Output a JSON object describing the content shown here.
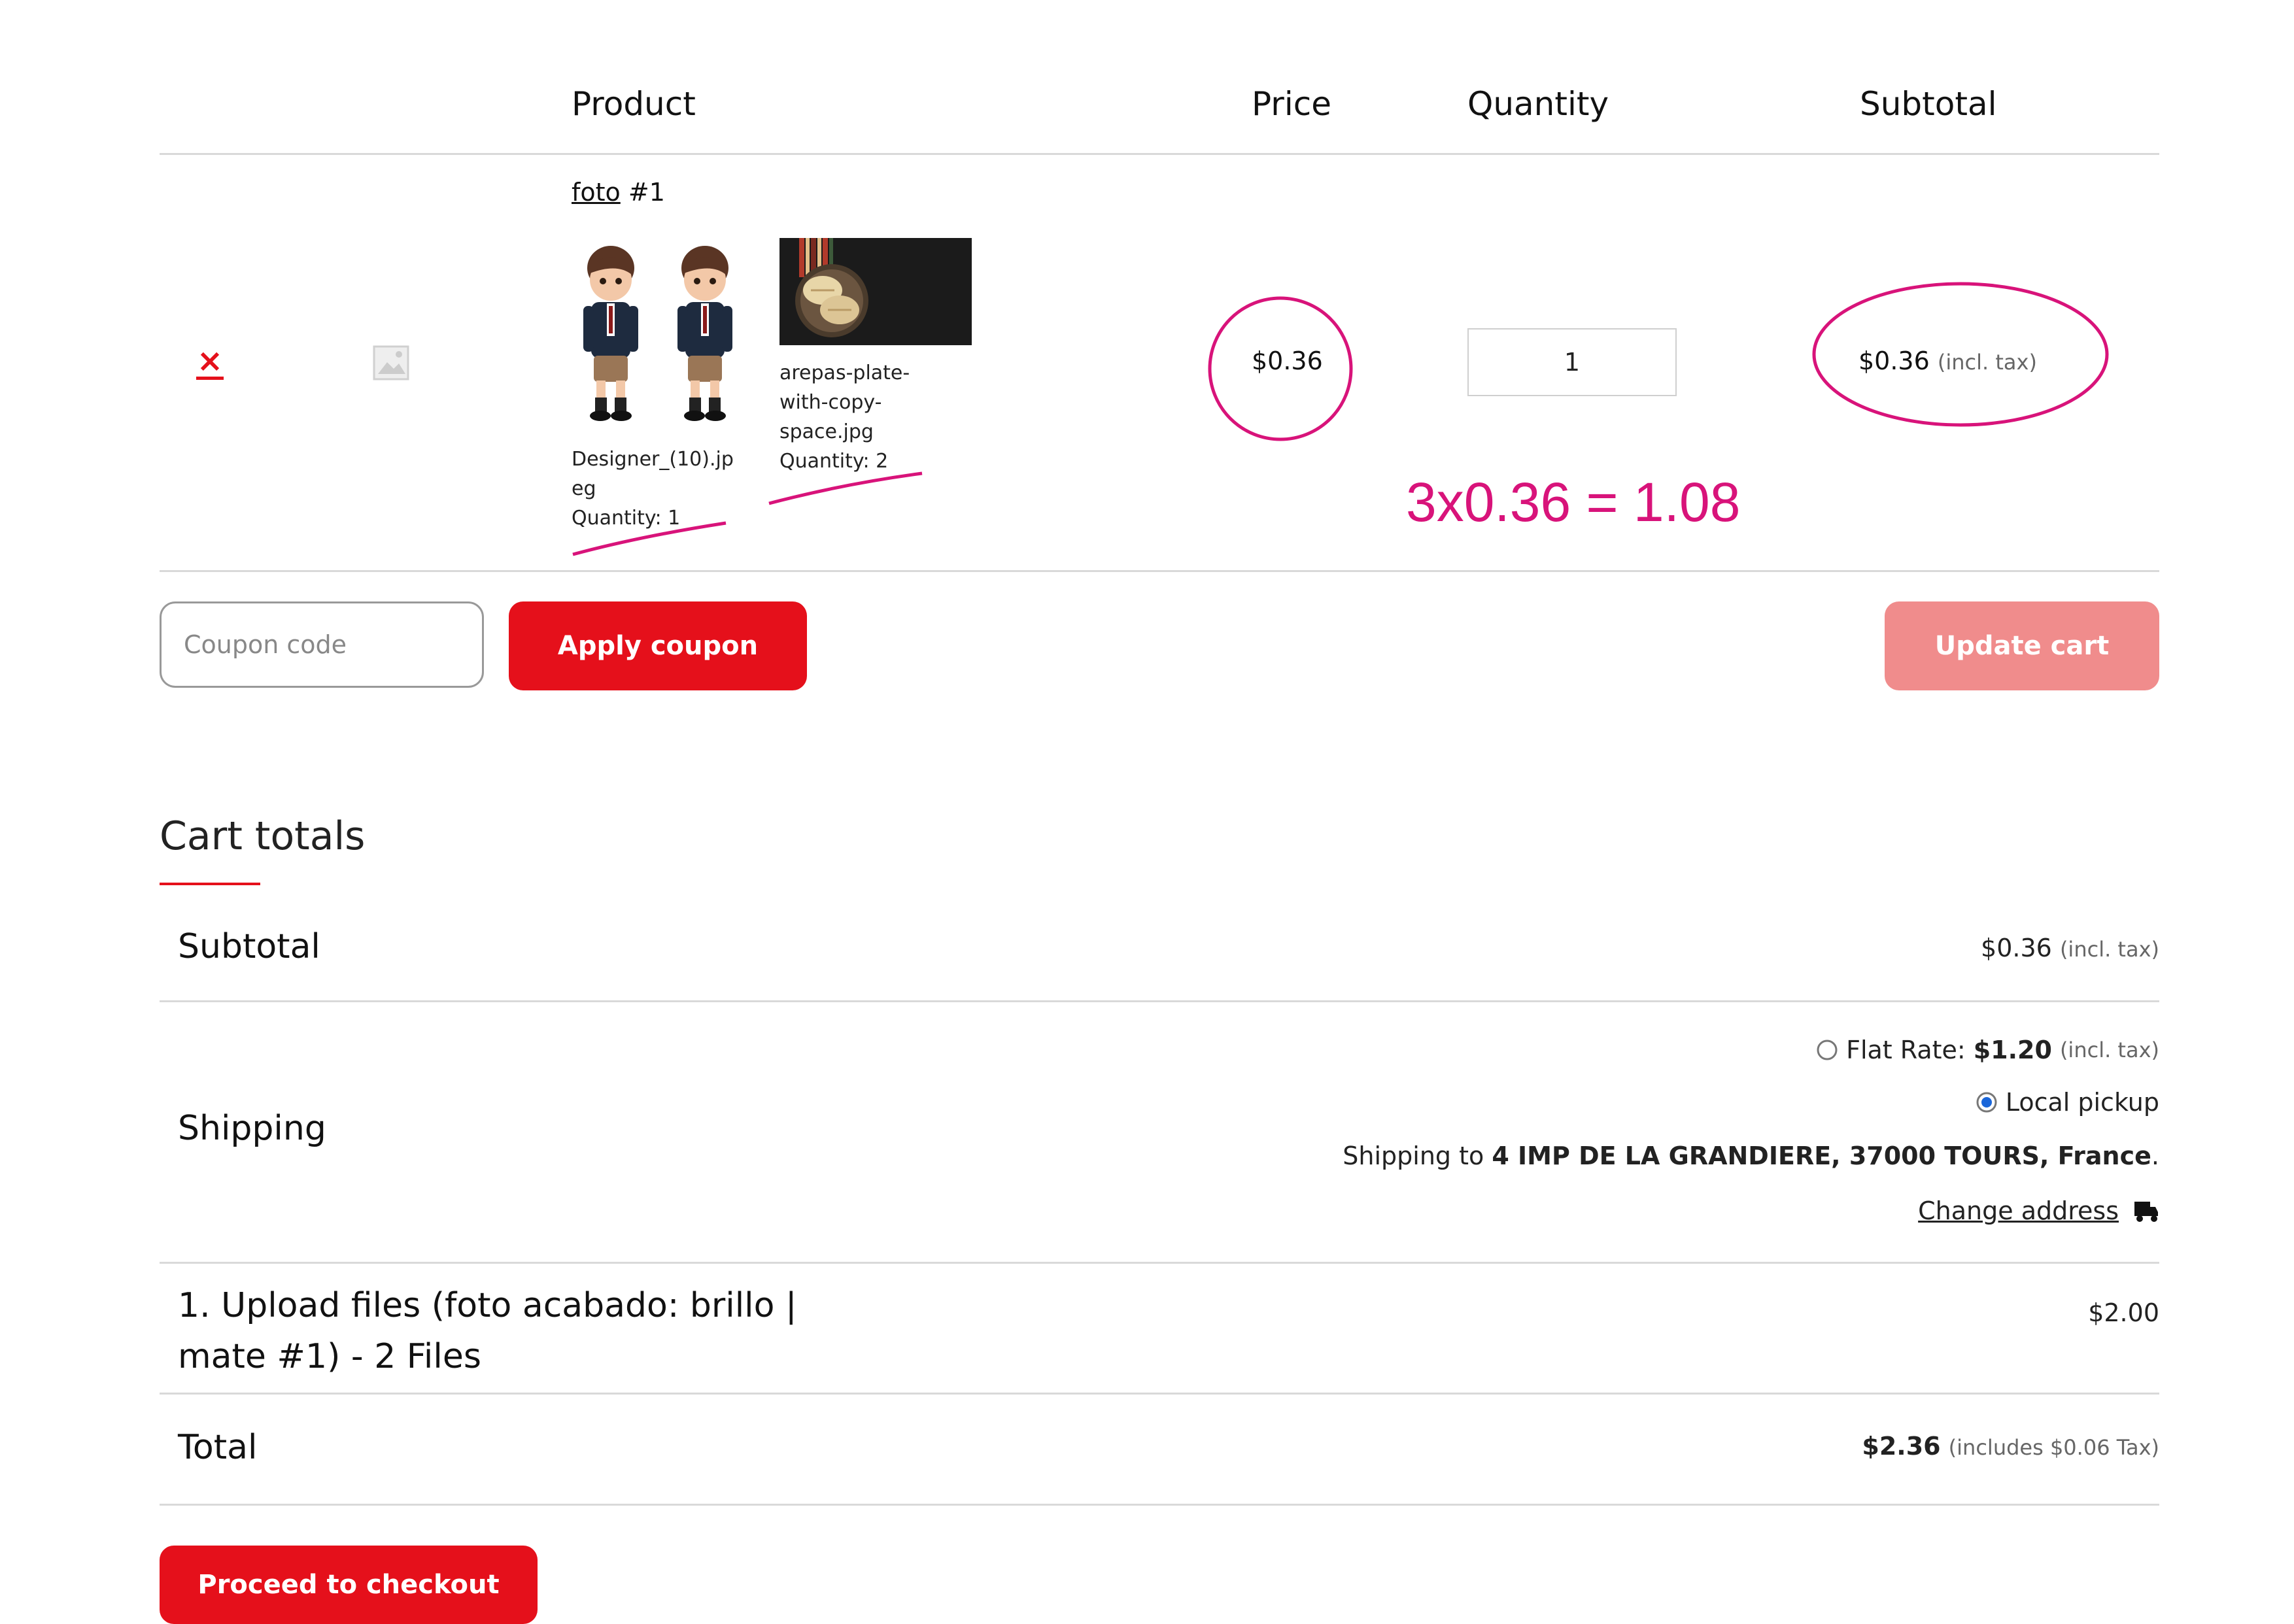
{
  "table_header": {
    "product": "Product",
    "price": "Price",
    "quantity": "Quantity",
    "subtotal": "Subtotal"
  },
  "cart_item": {
    "remove_symbol": "×",
    "title_link": "foto",
    "title_suffix": "#1",
    "files": [
      {
        "name_line1": "Designer_(10).jp",
        "name_line2": "eg",
        "quantity": "Quantity: 1"
      },
      {
        "name_line1": "arepas-plate-",
        "name_line2": "with-copy-",
        "name_line3": "space.jpg",
        "quantity": "Quantity: 2"
      }
    ],
    "price": "$0.36",
    "quantity_value": "1",
    "subtotal": "$0.36",
    "subtotal_tax_note": "(incl. tax)"
  },
  "annotation": {
    "formula": "3x0.36 = 1.08",
    "color": "#d8137a"
  },
  "coupon": {
    "placeholder": "Coupon code",
    "apply_label": "Apply coupon",
    "update_label": "Update cart"
  },
  "cart_totals": {
    "heading": "Cart totals",
    "subtotal_label": "Subtotal",
    "subtotal_value": "$0.36",
    "subtotal_tax_note": "(incl. tax)",
    "shipping_label": "Shipping",
    "shipping_options": [
      {
        "label": "Flat Rate:",
        "amount": "$1.20",
        "tax_note": "(incl. tax)",
        "selected": false
      },
      {
        "label": "Local pickup",
        "selected": true
      }
    ],
    "shipping_to_prefix": "Shipping to",
    "shipping_address": "4 IMP DE LA GRANDIERE, 37000 TOURS, France",
    "change_address": "Change address",
    "fee_label_line1": "1. Upload files (foto acabado: brillo |",
    "fee_label_line2": "mate #1) - 2 Files",
    "fee_value": "$2.00",
    "total_label": "Total",
    "total_value": "$2.36",
    "total_tax_note": "(includes $0.06 Tax)"
  },
  "checkout_label": "Proceed to checkout",
  "colors": {
    "accent": "#e5101b",
    "accent_disabled": "#f08c8c",
    "annotation": "#d8137a"
  }
}
